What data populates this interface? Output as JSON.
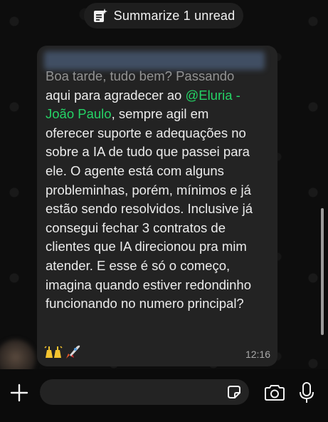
{
  "header": {
    "summarize_label": "Summarize 1 unread",
    "summarize_icon": "document-sparkle-icon"
  },
  "message": {
    "first_line": "Boa tarde, tudo bem? Passando",
    "line_2_prefix": "aqui para agradecer ao ",
    "mention_line_2": "@Eluria -",
    "mention_line_3": "João Paulo",
    "line_3_suffix": ", sempre agil em",
    "body_rest": "oferecer suporte e adequações no\nsobre a IA de tudo que passei para\nele. O agente está com alguns\nprobleminhas, porém, mínimos e já\nestão sendo resolvidos. Inclusive já\nconsegui fechar 3 contratos de\nclientes que IA direcionou pra mim\natender. E esse é só o começo,\nimagina quando estiver redondinho\nfuncionando no numero principal?",
    "emojis": "🙌🚀",
    "time": "12:16"
  },
  "input_bar": {
    "attach_icon": "plus-icon",
    "sticker_icon": "sticker-icon",
    "camera_icon": "camera-icon",
    "mic_icon": "microphone-icon"
  },
  "colors": {
    "background": "#0b0b0b",
    "bubble": "#232323",
    "mention": "#25d366",
    "timestamp": "#a8a8a8"
  }
}
